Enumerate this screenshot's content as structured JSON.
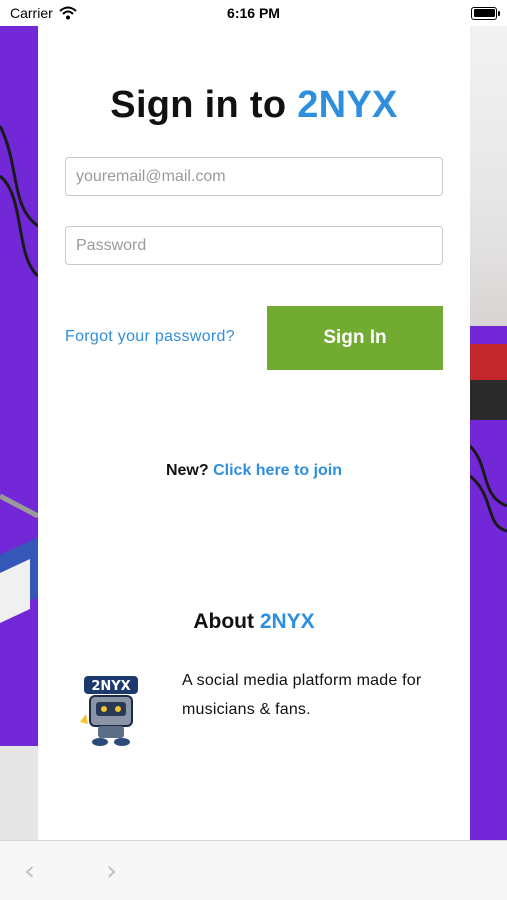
{
  "status_bar": {
    "carrier": "Carrier",
    "time": "6:16 PM",
    "wifi_icon": "wifi-icon",
    "battery_icon": "battery-icon"
  },
  "signin": {
    "title_prefix": "Sign in to ",
    "title_brand": "2NYX",
    "email_placeholder": "youremail@mail.com",
    "password_placeholder": "Password",
    "forgot_label": "Forgot your password?",
    "signin_label": "Sign In",
    "join_prefix": "New? ",
    "join_link": "Click here to join"
  },
  "about": {
    "title_prefix": "About ",
    "title_brand": "2NYX",
    "logo_icon": "2nyx-mascot-logo",
    "description": "A social media platform made for musicians & fans."
  },
  "toolbar": {
    "back_icon": "chevron-left-icon",
    "forward_icon": "chevron-right-icon"
  },
  "colors": {
    "brand_blue": "#2e8fde",
    "signin_green": "#72ab32",
    "background_purple": "#7326d8"
  }
}
